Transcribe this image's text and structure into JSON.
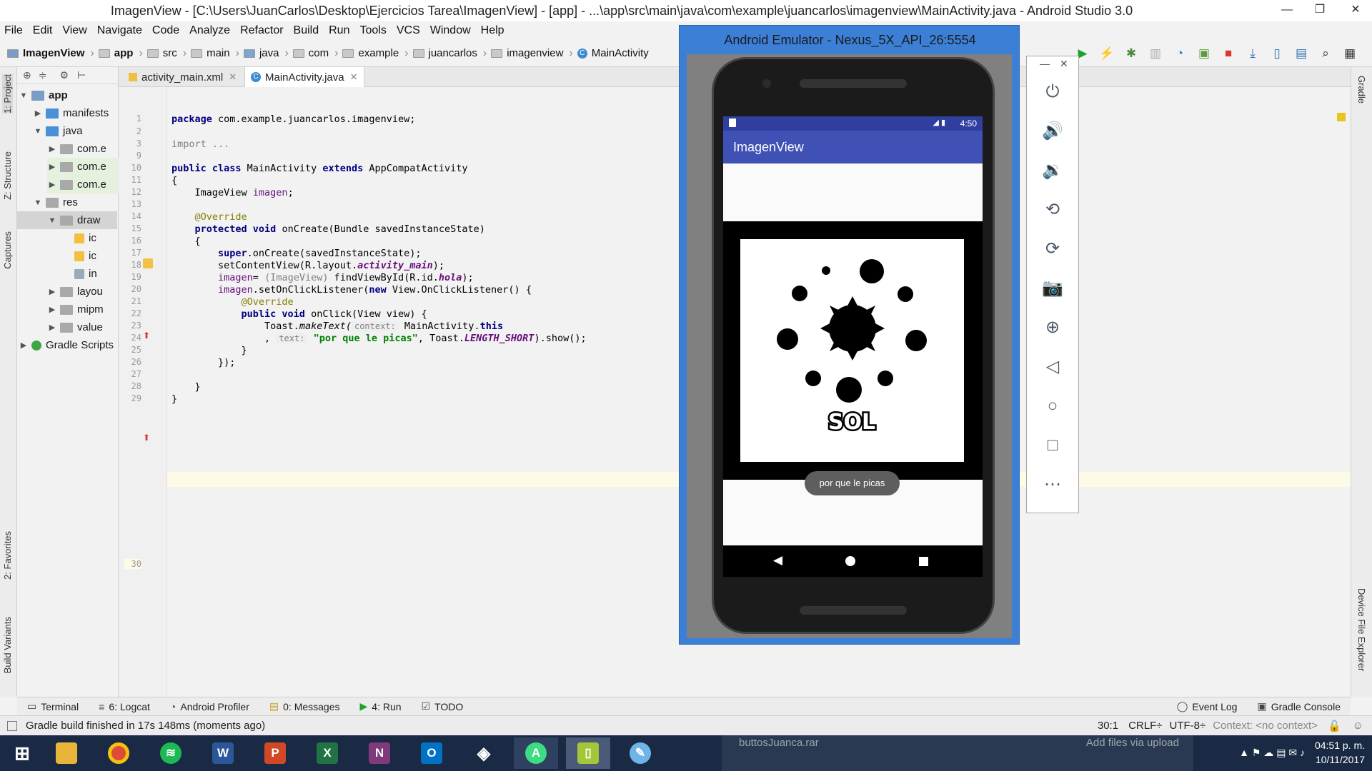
{
  "window": {
    "title": "ImagenView - [C:\\Users\\JuanCarlos\\Desktop\\Ejercicios Tarea\\ImagenView] - [app] - ...\\app\\src\\main\\java\\com\\example\\juancarlos\\imagenview\\MainActivity.java - Android Studio 3.0",
    "minimize": "—",
    "maximize": "❐",
    "close": "✕"
  },
  "menu": [
    "File",
    "Edit",
    "View",
    "Navigate",
    "Code",
    "Analyze",
    "Refactor",
    "Build",
    "Run",
    "Tools",
    "VCS",
    "Window",
    "Help"
  ],
  "breadcrumbs": [
    "ImagenView",
    "app",
    "src",
    "main",
    "java",
    "com",
    "example",
    "juancarlos",
    "imagenview",
    "MainActivity"
  ],
  "tabs": [
    {
      "label": "activity_main.xml"
    },
    {
      "label": "MainActivity.java"
    }
  ],
  "left_strip": {
    "project": "1: Project",
    "structure": "Z: Structure",
    "captures": "Captures",
    "favorites": "2: Favorites",
    "build_variants": "Build Variants"
  },
  "right_strip": {
    "gradle": "Gradle",
    "device_explorer": "Device File Explorer"
  },
  "project_tree": [
    {
      "label": "app",
      "bold": true
    },
    {
      "label": "manifests"
    },
    {
      "label": "java"
    },
    {
      "label": "com.e"
    },
    {
      "label": "com.e"
    },
    {
      "label": "com.e"
    },
    {
      "label": "res"
    },
    {
      "label": "draw"
    },
    {
      "label": "ic"
    },
    {
      "label": "ic"
    },
    {
      "label": "in"
    },
    {
      "label": "layou"
    },
    {
      "label": "mipm"
    },
    {
      "label": "value"
    },
    {
      "label": "Gradle Scripts"
    }
  ],
  "line_numbers": [
    "1",
    "2",
    "3",
    "9",
    "10",
    "11",
    "12",
    "13",
    "14",
    "15",
    "16",
    "17",
    "18",
    "19",
    "20",
    "21",
    "22",
    "23",
    "24",
    "25",
    "26",
    "27",
    "28",
    "29",
    "30"
  ],
  "code": {
    "l1a": "package",
    "l1b": " com.example.juancarlos.imagenview;",
    "l3": "import ...",
    "l10a": "public class",
    "l10b": " MainActivity ",
    "l10c": "extends",
    "l10d": " AppCompatActivity",
    "l11": "{",
    "l12a": "    ImageView ",
    "l12b": "imagen",
    "l12c": ";",
    "l14": "    @Override",
    "l15a": "    protected void",
    "l15b": " onCreate(Bundle savedInstanceState)",
    "l16": "    {",
    "l17a": "        super",
    "l17b": ".onCreate(savedInstanceState);",
    "l18a": "        setContentView(R.layout.",
    "l18b": "activity_main",
    "l18c": ");",
    "l19a": "        imagen",
    "l19b": "= ",
    "l19c": "(ImageView)",
    "l19d": " findViewById(R.id.",
    "l19e": "hola",
    "l19f": ");",
    "l20a": "        imagen",
    "l20b": ".setOnClickListener(",
    "l20c": "new",
    "l20d": " View.OnClickListener() {",
    "l21": "            @Override",
    "l22a": "            public void",
    "l22b": " onClick(View view) {",
    "l23a": "                Toast.",
    "l23b": "makeText(",
    "l23c": "context:",
    "l23d": " MainActivity.",
    "l23e": "this",
    "l24a": "                , ",
    "l24b": "text:",
    "l24c": " \"por que le picas\"",
    "l24d": ", Toast.",
    "l24e": "LENGTH_SHORT",
    "l24f": ").show();",
    "l25": "            }",
    "l26": "        });",
    "l28": "    }",
    "l29": "}"
  },
  "bottom_tools": {
    "terminal": "Terminal",
    "logcat": "6: Logcat",
    "profiler": "Android Profiler",
    "messages": "0: Messages",
    "run": "4: Run",
    "todo": "TODO",
    "event_log": "Event Log",
    "gradle_console": "Gradle Console"
  },
  "status": {
    "message": "Gradle build finished in 17s 148ms (moments ago)",
    "position": "30:1",
    "line_sep": "CRLF÷",
    "encoding": "UTF-8÷",
    "context": "Context: <no context>"
  },
  "emulator": {
    "title": "Android Emulator - Nexus_5X_API_26:5554",
    "time": "4:50",
    "app_title": "ImagenView",
    "toast": "por que le picas",
    "image_text": "SOL"
  },
  "emulator_panel": {
    "minimize": "—",
    "close": "✕",
    "buttons": [
      "power-icon",
      "volume-up-icon",
      "volume-down-icon",
      "rotate-left-icon",
      "rotate-right-icon",
      "camera-icon",
      "zoom-icon",
      "back-icon",
      "home-icon",
      "overview-icon",
      "more-icon"
    ]
  },
  "taskbar": {
    "apps": [
      "windows",
      "explorer",
      "chrome",
      "spotify",
      "word",
      "powerpoint",
      "excel",
      "onenote",
      "outlook",
      "unity",
      "android-studio",
      "emulator",
      "paint"
    ],
    "behind_text": "buttosJuanca.rar",
    "behind_text2": "Add files via upload",
    "clock_time": "04:51 p. m.",
    "clock_date": "10/11/2017"
  },
  "colors": {
    "keyword": "#000080",
    "annotation": "#808000",
    "string": "#008000",
    "field": "#660e7a",
    "app_bar": "#3f51b5",
    "status_bar": "#303f9f",
    "taskbar": "#1a2a44"
  }
}
